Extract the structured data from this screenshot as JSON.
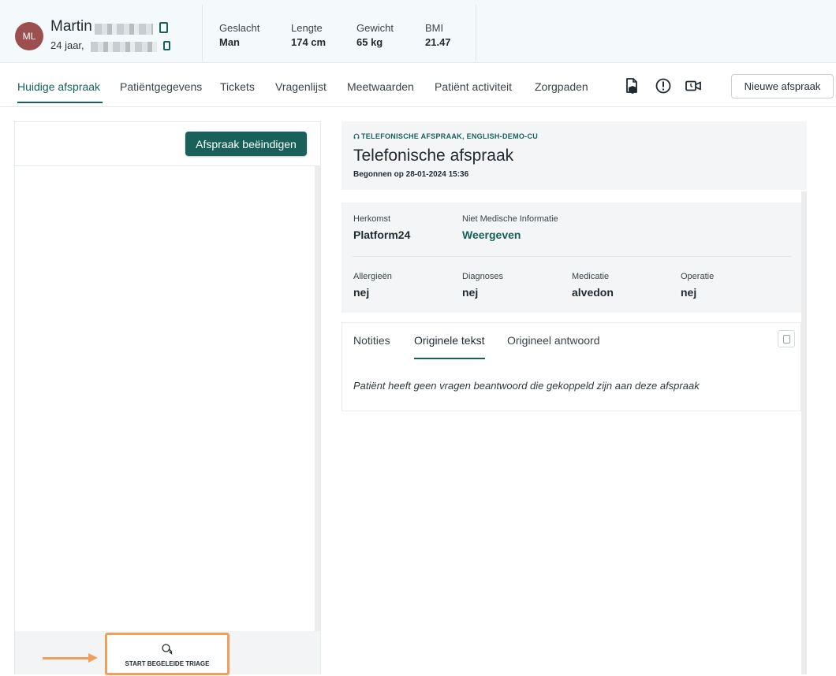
{
  "patient": {
    "initials": "ML",
    "first_name": "Martin",
    "age_text": "24 jaar,",
    "stats": [
      {
        "label": "Geslacht",
        "value": "Man"
      },
      {
        "label": "Lengte",
        "value": "174 cm"
      },
      {
        "label": "Gewicht",
        "value": "65 kg"
      },
      {
        "label": "BMI",
        "value": "21.47"
      }
    ]
  },
  "tabs": [
    {
      "label": "Huidige afspraak",
      "active": true
    },
    {
      "label": "Patiëntgegevens"
    },
    {
      "label": "Tickets"
    },
    {
      "label": "Vragenlijst"
    },
    {
      "label": "Meetwaarden"
    },
    {
      "label": "Patiënt activiteit"
    },
    {
      "label": "Zorgpaden"
    }
  ],
  "toolbar_icons": [
    "document-shield-icon",
    "alert-circle-icon",
    "video-call-icon"
  ],
  "new_appointment_label": "Nieuwe afspraak",
  "left_panel": {
    "end_appointment_label": "Afspraak beëindigen",
    "triage_label": "START BEGELEIDE TRIAGE",
    "triage_icon": "chat-bubbles-icon"
  },
  "appointment": {
    "type_label": "TELEFONISCHE AFSPRAAK, ENGLISH-DEMO-CU",
    "type_icon": "headset-icon",
    "title": "Telefonische afspraak",
    "started": "Begonnen op 28-01-2024 15:36"
  },
  "info": {
    "herkomst": {
      "label": "Herkomst",
      "value": "Platform24"
    },
    "niet_medisch": {
      "label": "Niet Medische Informatie",
      "value": "Weergeven"
    },
    "allergieen": {
      "label": "Allergieën",
      "value": "nej"
    },
    "diagnoses": {
      "label": "Diagnoses",
      "value": "nej"
    },
    "medicatie": {
      "label": "Medicatie",
      "value": "alvedon"
    },
    "operatie": {
      "label": "Operatie",
      "value": "nej"
    }
  },
  "notes": {
    "tabs": [
      {
        "label": "Notities"
      },
      {
        "label": "Originele tekst",
        "active": true
      },
      {
        "label": "Origineel antwoord"
      }
    ],
    "text": "Patiënt heeft geen vragen beantwoord die gekoppeld zijn aan deze afspraak"
  },
  "colors": {
    "accent": "#17615a",
    "avatar": "#9c4f4f",
    "highlight": "#f0a05a"
  }
}
